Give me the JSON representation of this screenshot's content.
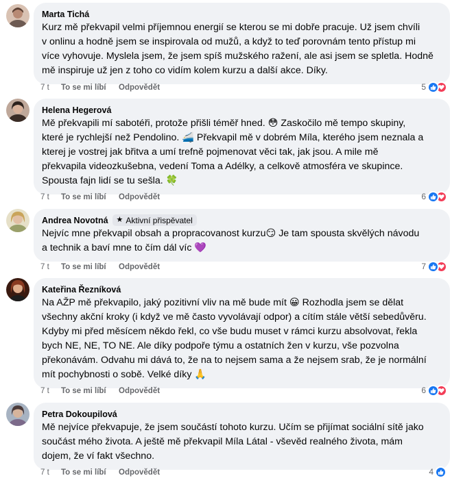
{
  "comments": [
    {
      "author": "Marta Tichá",
      "badge": null,
      "text": "Kurz mě překvapil velmi příjemnou energií se kterou se mi dobře pracuje. Už jsem chvíli\nv onlinu a hodně jsem se inspirovala od mužů, a když to teď porovnám tento přístup mi\nvíce vyhovuje. Myslela jsem, že jsem spíš mužského ražení, ale asi jsem se spletla. Hodně\nmě inspiruje už jen z toho co vidím kolem kurzu a další akce. Díky.",
      "time": "7 t",
      "like_label": "To se mi líbí",
      "reply_label": "Odpovědět",
      "reaction_count": "5",
      "reactions": [
        "like-icon",
        "heart-icon"
      ],
      "avatar_color": "#b88a74"
    },
    {
      "author": "Helena Hegerová",
      "badge": null,
      "text": "Mě překvapili mí sabotéři, protože přišli téměř hned. 😳 Zaskočilo mě tempo skupiny,\nkteré je rychlejší než Pendolino. 🚄 Překvapil mě v dobrém Míla, kterého jsem neznala a\nkterej je vostrej jak břitva a umí trefně pojmenovat věci tak, jak jsou. A mile mě\npřekvapila videozkušebna, vedení Toma a Adélky, a celkově atmosféra ve skupince.\nSpousta fajn lidí se tu sešla. 🍀",
      "time": "7 t",
      "like_label": "To se mi líbí",
      "reply_label": "Odpovědět",
      "reaction_count": "6",
      "reactions": [
        "like-icon",
        "heart-icon"
      ],
      "avatar_color": "#4a3a33"
    },
    {
      "author": "Andrea Novotná",
      "badge": "Aktivní přispěvatel",
      "text": "Nejvíc mne překvapil obsah a propracovanost kurzu😏 Je tam spousta skvělých návodu\na technik a baví mne to čím dál víc 💜",
      "time": "7 t",
      "like_label": "To se mi líbí",
      "reply_label": "Odpovědět",
      "reaction_count": "7",
      "reactions": [
        "like-icon",
        "heart-icon"
      ],
      "avatar_color": "#c9a45a"
    },
    {
      "author": "Kateřina Řezníková",
      "badge": null,
      "text": "Na AŽP mě překvapilo, jaký pozitivní vliv na mě bude mít 😀 Rozhodla jsem se dělat\nvšechny akční kroky (i když ve mě často vyvolávají odpor) a cítím stále větší sebedůvěru.\nKdyby mi před měsícem někdo řekl, co vše budu muset v rámci kurzu absolvovat, řekla\nbych NE, NE, TO NE. Ale díky podpoře týmu a ostatních žen v kurzu, vše pozvolna\npřekonávám. Odvahu mi dává to, že na to nejsem sama a že nejsem srab, že je normální\nmít pochybnosti o sobě. Velké díky 🙏",
      "time": "7 t",
      "like_label": "To se mi líbí",
      "reply_label": "Odpovědět",
      "reaction_count": "6",
      "reactions": [
        "like-icon",
        "heart-icon"
      ],
      "avatar_color": "#8a3b22"
    },
    {
      "author": "Petra Dokoupilová",
      "badge": null,
      "text": "Mě nejvíce překvapuje, že jsem součástí tohoto kurzu. Učím se přijímat sociální sítě jako\nsoučást mého života. A ještě mě překvapil Míla Látal - vševěd realného života, mám\ndojem, že ví fakt všechno.",
      "time": "7 t",
      "like_label": "To se mi líbí",
      "reply_label": "Odpovědět",
      "reaction_count": "4",
      "reactions": [
        "like-icon"
      ],
      "avatar_color": "#7c6a8a"
    }
  ]
}
